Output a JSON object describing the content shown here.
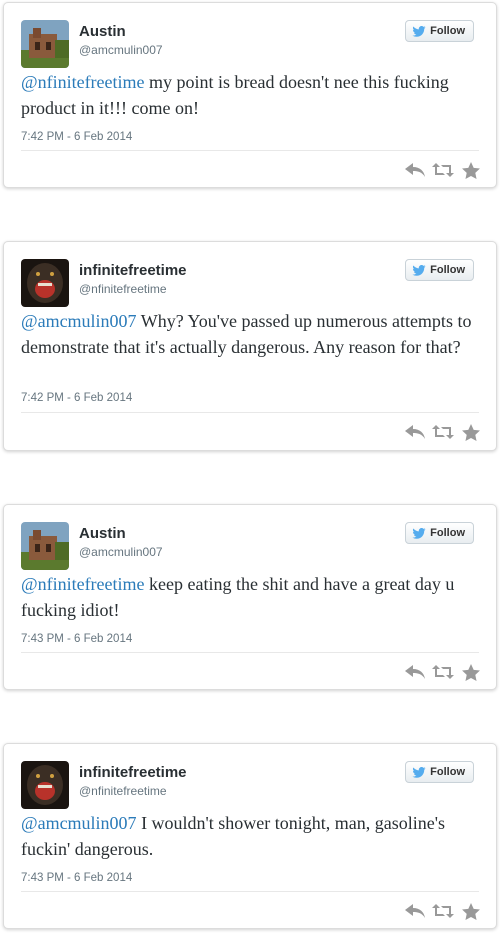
{
  "follow_label": "Follow",
  "icons": {
    "reply": "reply-icon",
    "retweet": "retweet-icon",
    "favorite": "favorite-star-icon",
    "bird": "twitter-bird-icon"
  },
  "colors": {
    "link": "#2b7bb9",
    "follow_bird": "#55acee",
    "action_gray": "#999999"
  },
  "tweets": [
    {
      "name": "Austin",
      "handle": "@amcmulin007",
      "mention": "@nfinitefreetime",
      "text": " my point is bread doesn't nee this fucking product in it!!! come on!",
      "time": "7:42 PM - 6 Feb 2014"
    },
    {
      "name": "infinitefreetime",
      "handle": "@nfinitefreetime",
      "mention": "@amcmulin007",
      "text": " Why?  You've passed up numerous attempts to demonstrate that it's actually dangerous.  Any reason for that?",
      "time": "7:42 PM - 6 Feb 2014"
    },
    {
      "name": "Austin",
      "handle": "@amcmulin007",
      "mention": "@nfinitefreetime",
      "text": " keep eating the shit and have a great day u fucking idiot!",
      "time": "7:43 PM - 6 Feb 2014"
    },
    {
      "name": "infinitefreetime",
      "handle": "@nfinitefreetime",
      "mention": "@amcmulin007",
      "text": " I wouldn't shower tonight, man, gasoline's fuckin' dangerous.",
      "time": "7:43 PM - 6 Feb 2014"
    }
  ]
}
